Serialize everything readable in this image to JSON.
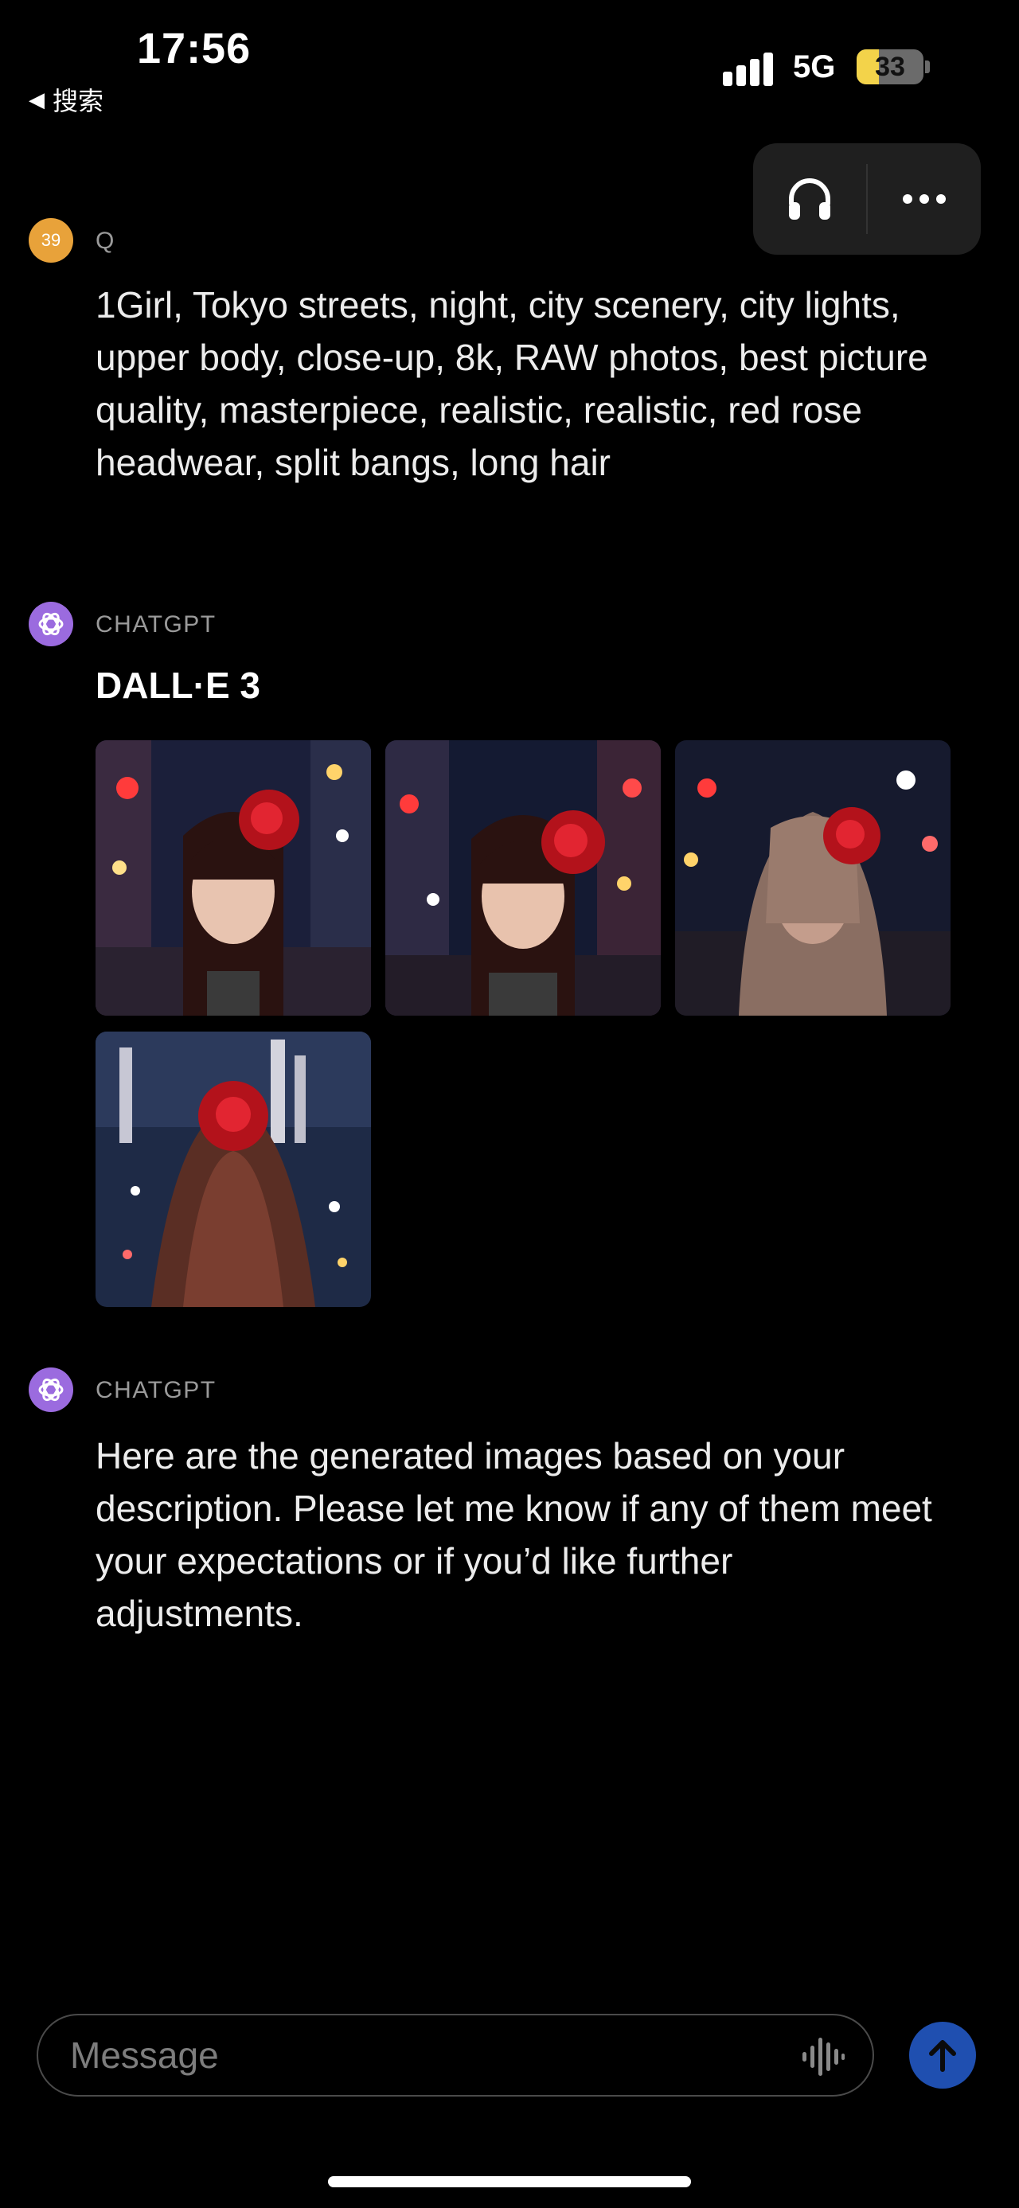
{
  "status_bar": {
    "time": "17:56",
    "back_label": "搜索",
    "network": "5G",
    "battery": "33",
    "battery_level": 0.33
  },
  "header": {
    "headphones_icon": "headphones-icon",
    "more_icon": "ellipsis-icon"
  },
  "messages": [
    {
      "sender": "Q",
      "avatar_text": "39",
      "text": "1Girl, Tokyo streets, night, city scenery, city lights, upper body, close-up, 8k, RAW photos, best picture quality, masterpiece, realistic, realistic, red rose headwear, split bangs, long hair"
    },
    {
      "sender": "CHATGPT",
      "tool_label": "DALL·E 3",
      "images": [
        "generated-image-1",
        "generated-image-2",
        "generated-image-3",
        "generated-image-4"
      ]
    },
    {
      "sender": "CHATGPT",
      "text": "Here are the generated images based on your description. Please let me know if any of them meet your expectations or if you’d like further adjustments."
    }
  ],
  "composer": {
    "placeholder": "Message",
    "voice_icon": "waveform-icon",
    "send_icon": "arrow-up-icon"
  },
  "colors": {
    "background": "#000000",
    "user_avatar": "#e8a23a",
    "assistant_avatar": "#9b6bdf",
    "send_button": "#1f4fb0",
    "battery_fill": "#f3d34a"
  }
}
